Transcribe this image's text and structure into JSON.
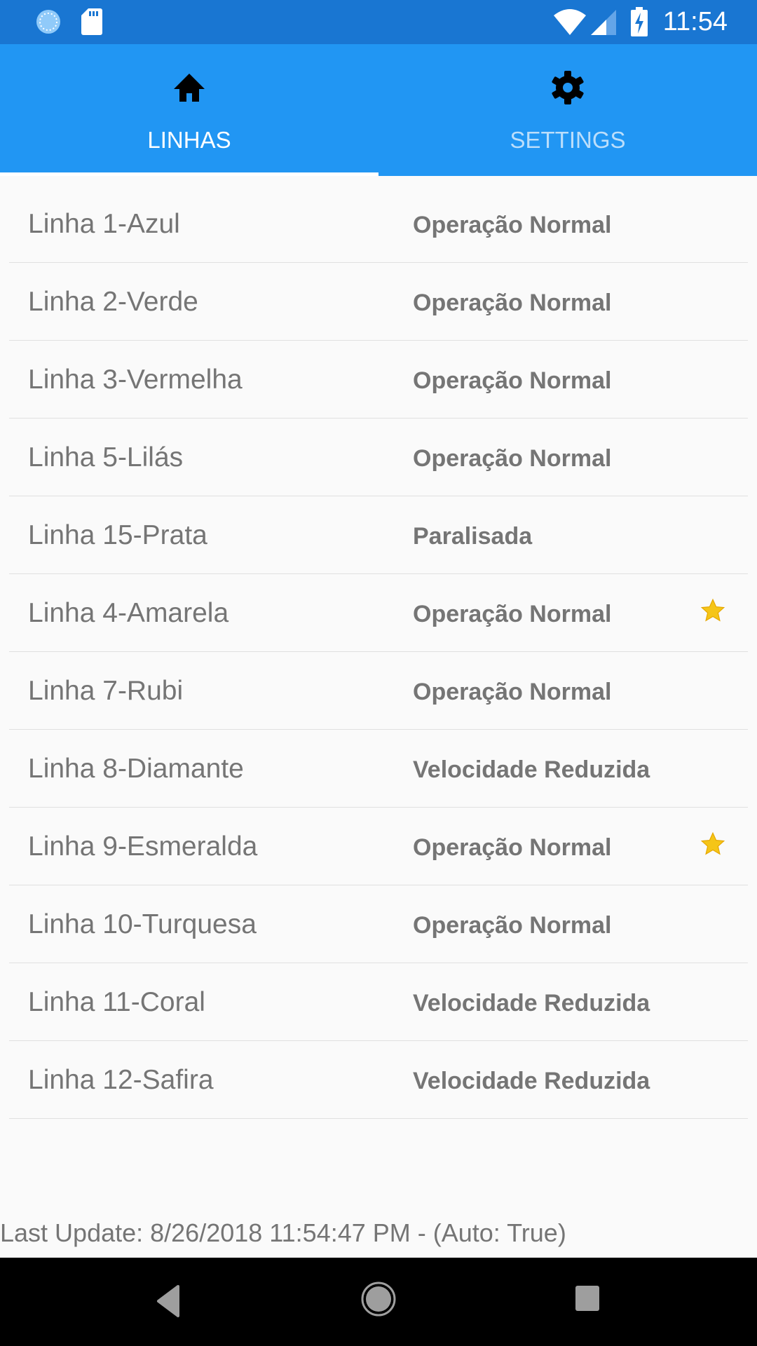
{
  "status_bar": {
    "time": "11:54"
  },
  "tabs": [
    {
      "label": "LINHAS",
      "icon": "home-icon",
      "active": true
    },
    {
      "label": "SETTINGS",
      "icon": "gear-icon",
      "active": false
    }
  ],
  "lines": [
    {
      "name": "Linha 1-Azul",
      "status": "Operação Normal",
      "favorite": false
    },
    {
      "name": "Linha 2-Verde",
      "status": "Operação Normal",
      "favorite": false
    },
    {
      "name": "Linha 3-Vermelha",
      "status": "Operação Normal",
      "favorite": false
    },
    {
      "name": "Linha 5-Lilás",
      "status": "Operação Normal",
      "favorite": false
    },
    {
      "name": "Linha 15-Prata",
      "status": "Paralisada",
      "favorite": false
    },
    {
      "name": "Linha 4-Amarela",
      "status": "Operação Normal",
      "favorite": true
    },
    {
      "name": "Linha 7-Rubi",
      "status": "Operação Normal",
      "favorite": false
    },
    {
      "name": "Linha 8-Diamante",
      "status": "Velocidade Reduzida",
      "favorite": false
    },
    {
      "name": "Linha 9-Esmeralda",
      "status": "Operação Normal",
      "favorite": true
    },
    {
      "name": "Linha 10-Turquesa",
      "status": "Operação Normal",
      "favorite": false
    },
    {
      "name": "Linha 11-Coral",
      "status": "Velocidade Reduzida",
      "favorite": false
    },
    {
      "name": "Linha 12-Safira",
      "status": "Velocidade Reduzida",
      "favorite": false
    }
  ],
  "footer": {
    "last_update": "Last Update: 8/26/2018 11:54:47 PM - (Auto: True)"
  },
  "colors": {
    "status_bar": "#1976D2",
    "tab_bar": "#2196F3",
    "star": "#F5C518",
    "text": "#757575"
  }
}
